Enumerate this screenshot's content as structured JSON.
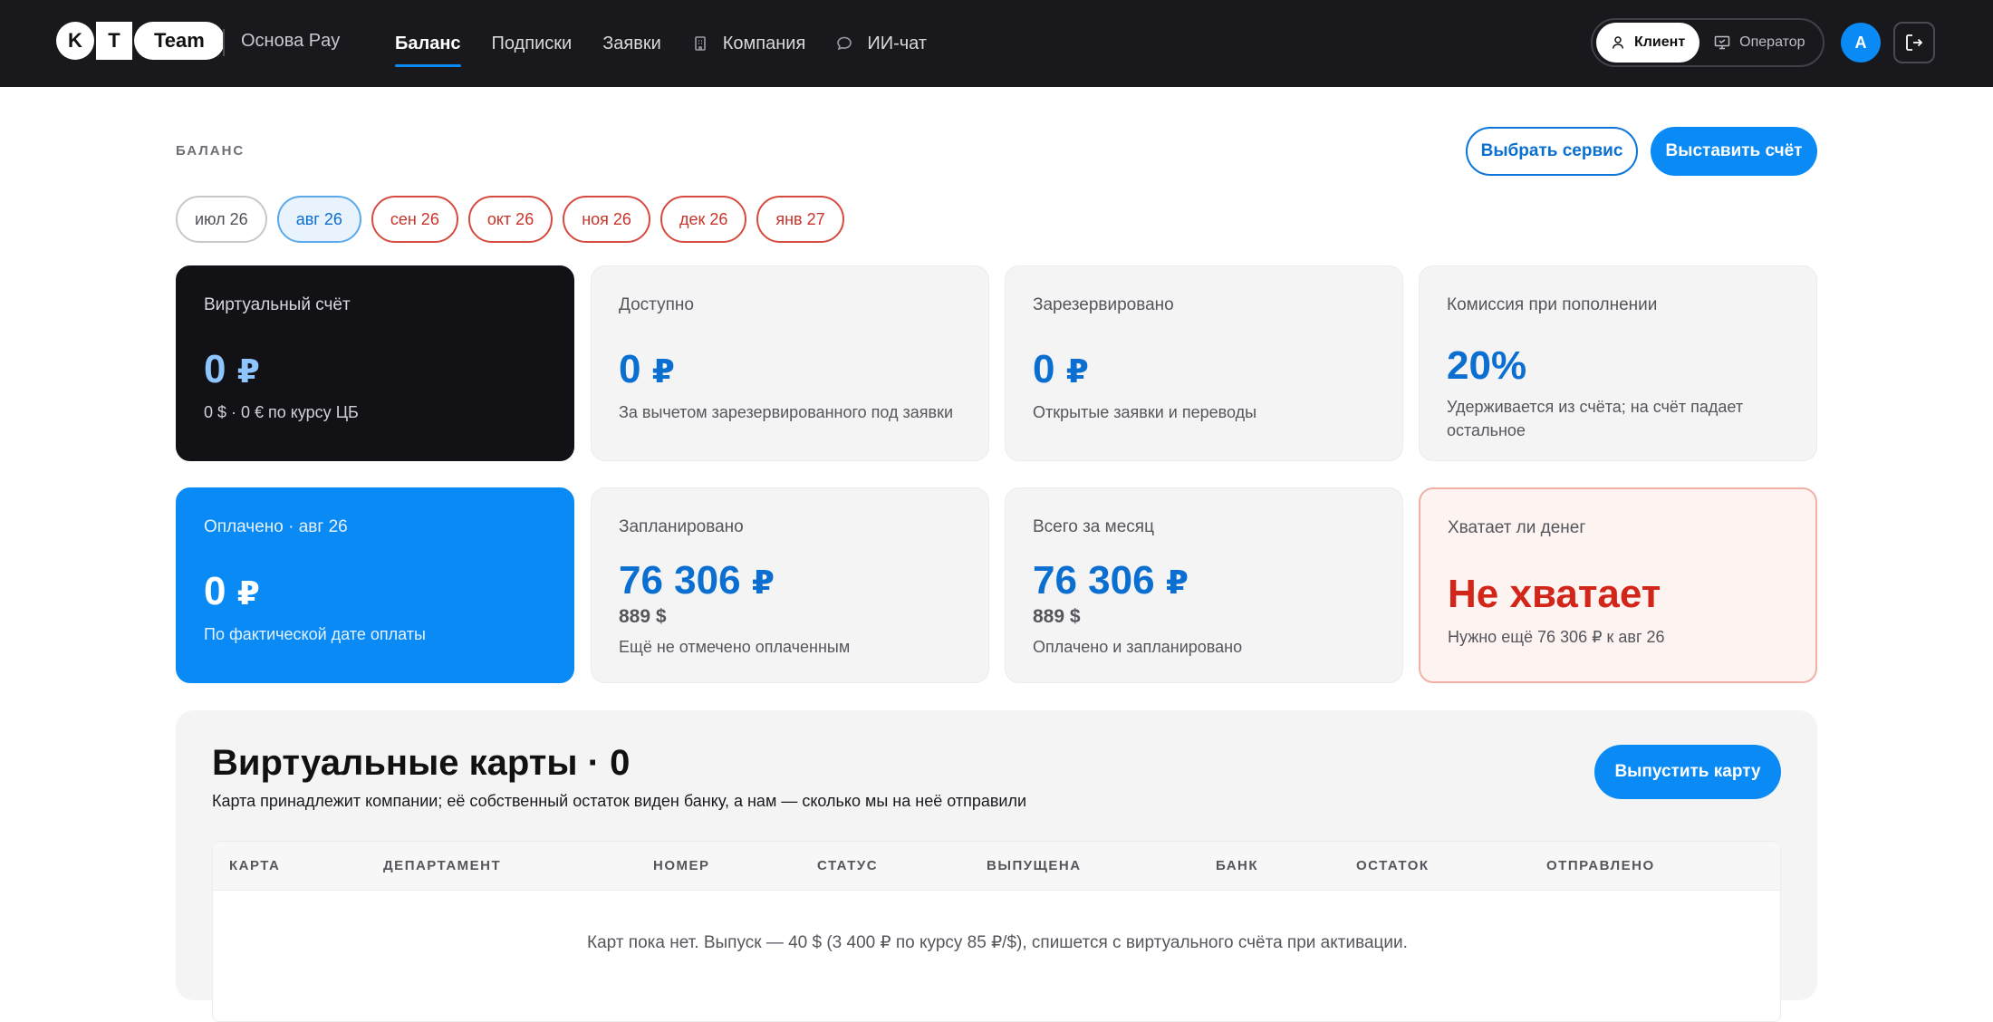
{
  "brand": {
    "logo_k": "K",
    "logo_t": "T",
    "logo_team": "Team",
    "product": "Основа Pay"
  },
  "nav": {
    "items": [
      {
        "label": "Баланс",
        "active": true
      },
      {
        "label": "Подписки"
      },
      {
        "label": "Заявки"
      },
      {
        "label": "Компания",
        "icon": "building-icon"
      },
      {
        "label": "ИИ-чат",
        "icon": "chat-bubble-icon"
      }
    ]
  },
  "roles": {
    "client": "Клиент",
    "operator": "Оператор",
    "active": "client"
  },
  "user": {
    "avatar_letter": "A"
  },
  "page": {
    "section_label": "БАЛАНС",
    "choose_service": "Выбрать сервис",
    "issue_invoice": "Выставить счёт"
  },
  "months": [
    {
      "label": "июл 26",
      "state": "neutral"
    },
    {
      "label": "авг 26",
      "state": "active"
    },
    {
      "label": "сен 26",
      "state": "warn"
    },
    {
      "label": "окт 26",
      "state": "warn"
    },
    {
      "label": "ноя 26",
      "state": "warn"
    },
    {
      "label": "дек 26",
      "state": "warn"
    },
    {
      "label": "янв 27",
      "state": "warn"
    }
  ],
  "cards": {
    "virtual": {
      "title": "Виртуальный счёт",
      "amount": "0",
      "currency": "₽",
      "sub": "0 $ · 0 € по курсу ЦБ"
    },
    "available": {
      "title": "Доступно",
      "amount": "0",
      "currency": "₽",
      "sub": "За вычетом зарезервированного под заявки"
    },
    "reserved": {
      "title": "Зарезервировано",
      "amount": "0",
      "currency": "₽",
      "sub": "Открытые заявки и переводы"
    },
    "commission": {
      "title": "Комиссия при пополнении",
      "amount": "20%",
      "sub": "Удерживается из счёта; на счёт падает остальное"
    },
    "paid": {
      "title": "Оплачено · авг 26",
      "amount": "0",
      "currency": "₽",
      "sub": "По фактической дате оплаты"
    },
    "planned": {
      "title": "Запланировано",
      "amount": "76 306",
      "currency": "₽",
      "usd": "889 $",
      "sub": "Ещё не отмечено оплаченным"
    },
    "month_total": {
      "title": "Всего за месяц",
      "amount": "76 306",
      "currency": "₽",
      "usd": "889 $",
      "sub": "Оплачено и запланировано"
    },
    "enough": {
      "title": "Хватает ли денег",
      "amount": "Не хватает",
      "sub": "Нужно ещё 76 306 ₽ к авг 26"
    }
  },
  "virtual_cards": {
    "title": "Виртуальные карты · 0",
    "description": "Карта принадлежит компании; её собственный остаток виден банку, а нам — сколько мы на неё отправили",
    "issue_button": "Выпустить карту",
    "columns": [
      "КАРТА",
      "ДЕПАРТАМЕНТ",
      "НОМЕР",
      "СТАТУС",
      "ВЫПУЩЕНА",
      "БАНК",
      "ОСТАТОК",
      "ОТПРАВЛЕНО"
    ],
    "empty_text": "Карт пока нет. Выпуск — 40 $ (3 400 ₽ по курсу 85 ₽/$), спишется с виртуального счёта при активации."
  },
  "colors": {
    "accent": "#0a8af5",
    "topbar": "#19191d",
    "warn": "#d3261b"
  }
}
